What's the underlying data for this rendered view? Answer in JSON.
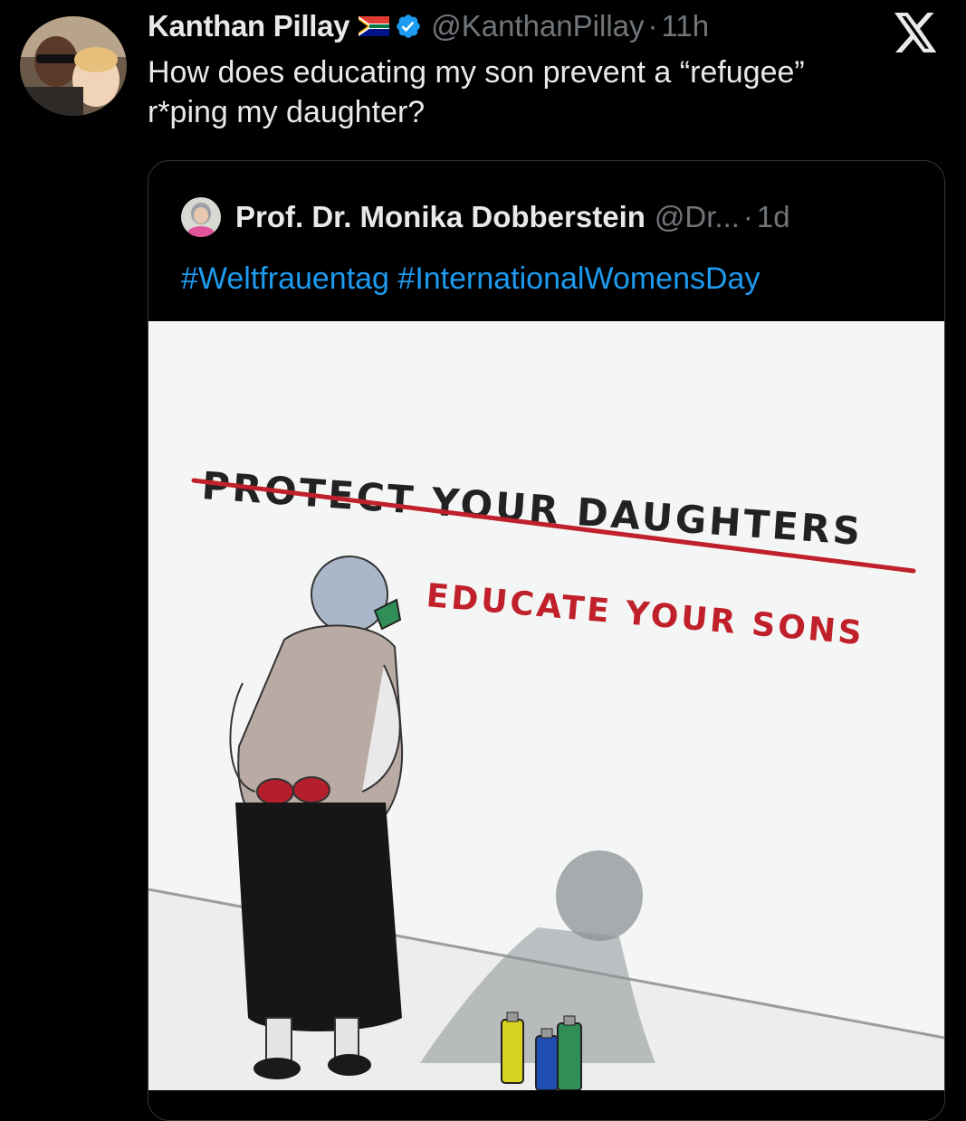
{
  "tweet": {
    "display_name": "Kanthan Pillay",
    "flag_icon": "south-africa-flag-icon",
    "verified_icon": "verified-badge-icon",
    "handle": "@KanthanPillay",
    "separator": "·",
    "time": "11h",
    "text": "How does educating my son prevent a “refugee”\nr*ping my daughter?",
    "logo_icon": "x-logo-icon"
  },
  "quote": {
    "display_name": "Prof. Dr. Monika Dobberstein",
    "handle": "@Dr...",
    "separator": "·",
    "time": "1d",
    "hashtags": [
      "#Weltfrauentag",
      "#InternationalWomensDay"
    ],
    "media": {
      "crossed_out_text": "PROTECT YOUR DAUGHTERS",
      "painted_text": "EDUCATE YOUR SONS"
    }
  },
  "colors": {
    "background": "#000000",
    "text_primary": "#e7e9ea",
    "text_secondary": "#71767b",
    "link": "#1d9bf0",
    "verified": "#1d9bf0",
    "card_border": "#333639",
    "paint_red": "#c0202a"
  }
}
